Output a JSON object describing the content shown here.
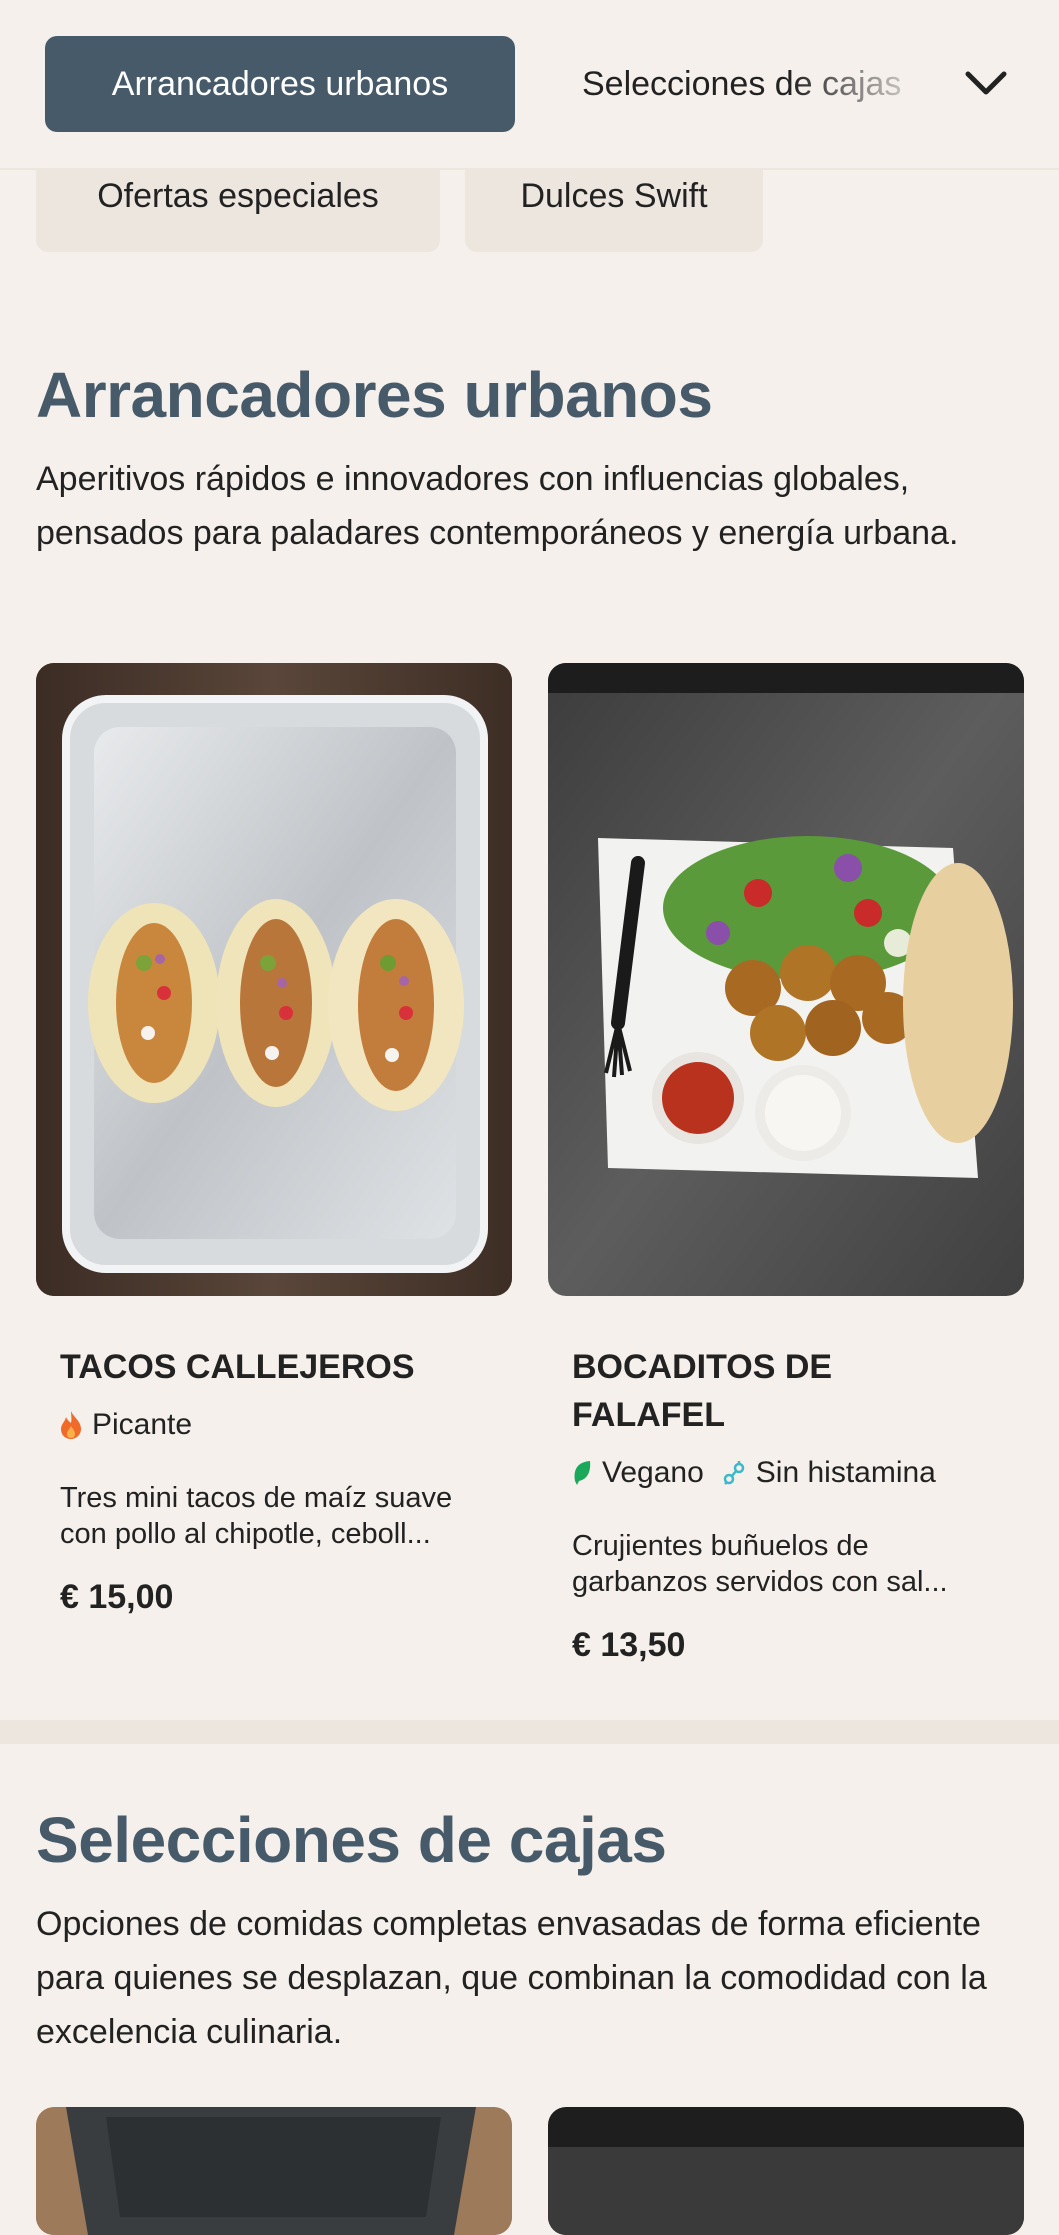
{
  "nav": {
    "active_tab": "Arrancadores urbanos",
    "next_tab": "Selecciones de cajas",
    "expand_icon": "chevron-down-icon"
  },
  "chips": [
    "Ofertas especiales",
    "Dulces Swift"
  ],
  "sections": [
    {
      "title": "Arrancadores urbanos",
      "description": "Aperitivos rápidos e innovadores con influencias globales, pensados para paladares contemporáneos y energía urbana.",
      "items": [
        {
          "name": "TACOS CALLEJEROS",
          "tags": [
            {
              "label": "Picante",
              "icon": "flame-icon"
            }
          ],
          "description_line1": "Tres mini tacos de maíz suave",
          "description_line2": "con pollo al chipotle, ceboll...",
          "price": "€ 15,00"
        },
        {
          "name_line1": "BOCADITOS DE",
          "name_line2": "FALAFEL",
          "tags": [
            {
              "label": "Vegano",
              "icon": "leaf-icon"
            },
            {
              "label": "Sin histamina",
              "icon": "histamine-free-icon"
            }
          ],
          "description_line1": "Crujientes buñuelos de",
          "description_line2": "garbanzos servidos con sal...",
          "price": "€ 13,50"
        }
      ]
    },
    {
      "title": "Selecciones de cajas",
      "description": "Opciones de comidas completas envasadas de forma eficiente para quienes se desplazan, que combinan la comodidad con la excelencia culinaria."
    }
  ],
  "colors": {
    "background": "#f5f0eb",
    "accent": "#475a69",
    "chip": "#ece6df",
    "spicy": "#f06a2a",
    "vegan": "#1aa85a",
    "histamine": "#3cb8c8"
  }
}
